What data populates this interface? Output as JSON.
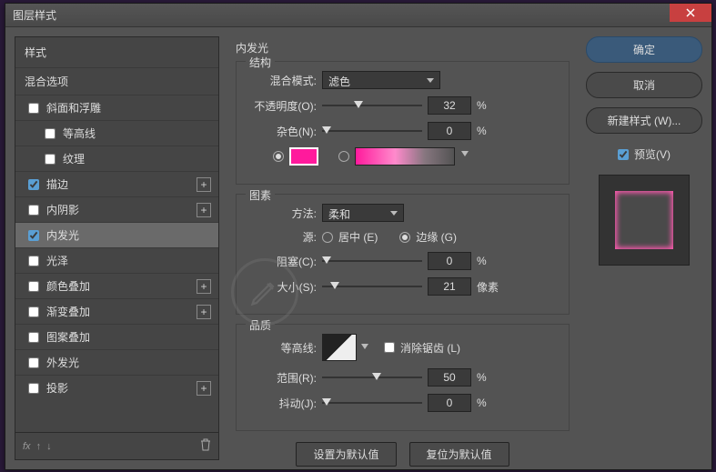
{
  "window": {
    "title": "图层样式"
  },
  "buttons": {
    "ok": "确定",
    "cancel": "取消",
    "new_style": "新建样式 (W)...",
    "preview": "预览(V)",
    "make_default": "设置为默认值",
    "reset_default": "复位为默认值"
  },
  "left": {
    "styles_header": "样式",
    "blend_options": "混合选项",
    "items": [
      {
        "label": "斜面和浮雕",
        "checked": false,
        "selected": false,
        "plus": false,
        "indent": false
      },
      {
        "label": "等高线",
        "checked": false,
        "selected": false,
        "plus": false,
        "indent": true
      },
      {
        "label": "纹理",
        "checked": false,
        "selected": false,
        "plus": false,
        "indent": true
      },
      {
        "label": "描边",
        "checked": true,
        "selected": false,
        "plus": true,
        "indent": false
      },
      {
        "label": "内阴影",
        "checked": false,
        "selected": false,
        "plus": true,
        "indent": false
      },
      {
        "label": "内发光",
        "checked": true,
        "selected": true,
        "plus": false,
        "indent": false
      },
      {
        "label": "光泽",
        "checked": false,
        "selected": false,
        "plus": false,
        "indent": false
      },
      {
        "label": "颜色叠加",
        "checked": false,
        "selected": false,
        "plus": true,
        "indent": false
      },
      {
        "label": "渐变叠加",
        "checked": false,
        "selected": false,
        "plus": true,
        "indent": false
      },
      {
        "label": "图案叠加",
        "checked": false,
        "selected": false,
        "plus": false,
        "indent": false
      },
      {
        "label": "外发光",
        "checked": false,
        "selected": false,
        "plus": false,
        "indent": false
      },
      {
        "label": "投影",
        "checked": false,
        "selected": false,
        "plus": true,
        "indent": false
      }
    ],
    "fx_label": "fx"
  },
  "center": {
    "title": "内发光",
    "structure": {
      "legend": "结构",
      "blend_mode_label": "混合模式:",
      "blend_mode_value": "滤色",
      "opacity_label": "不透明度(O):",
      "opacity_value": "32",
      "opacity_unit": "%",
      "noise_label": "杂色(N):",
      "noise_value": "0",
      "noise_unit": "%",
      "color_hex": "#ff1a9c"
    },
    "elements": {
      "legend": "图素",
      "technique_label": "方法:",
      "technique_value": "柔和",
      "source_label": "源:",
      "source_center": "居中 (E)",
      "source_edge": "边缘 (G)",
      "choke_label": "阻塞(C):",
      "choke_value": "0",
      "choke_unit": "%",
      "size_label": "大小(S):",
      "size_value": "21",
      "size_unit": "像素"
    },
    "quality": {
      "legend": "品质",
      "contour_label": "等高线:",
      "antialias_label": "消除锯齿 (L)",
      "range_label": "范围(R):",
      "range_value": "50",
      "range_unit": "%",
      "jitter_label": "抖动(J):",
      "jitter_value": "0",
      "jitter_unit": "%"
    }
  }
}
